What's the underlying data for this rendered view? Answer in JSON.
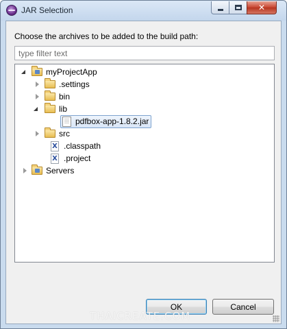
{
  "window": {
    "title": "JAR Selection",
    "icon": "eclipse-icon"
  },
  "dialog": {
    "prompt": "Choose the archives to be added to the build path:",
    "filter": {
      "value": "",
      "placeholder": "type filter text"
    }
  },
  "tree": {
    "project": {
      "label": "myProjectApp",
      "icon": "project-folder-icon",
      "expanded": true
    },
    "settings": {
      "label": ".settings",
      "icon": "folder-icon"
    },
    "bin": {
      "label": "bin",
      "icon": "folder-icon"
    },
    "lib": {
      "label": "lib",
      "icon": "folder-icon",
      "expanded": true
    },
    "jar": {
      "label": "pdfbox-app-1.8.2.jar",
      "icon": "jar-file-icon",
      "selected": true
    },
    "src": {
      "label": "src",
      "icon": "folder-icon"
    },
    "classpath": {
      "label": ".classpath",
      "icon": "xml-file-icon"
    },
    "project_file": {
      "label": ".project",
      "icon": "xml-file-icon"
    },
    "servers": {
      "label": "Servers",
      "icon": "project-folder-icon"
    }
  },
  "buttons": {
    "ok": "OK",
    "cancel": "Cancel"
  },
  "watermark": "THAICREATE.COM",
  "colors": {
    "titlebar": "#c9dbee",
    "selection": "#d9e6f7",
    "close_button": "#c7432f"
  }
}
